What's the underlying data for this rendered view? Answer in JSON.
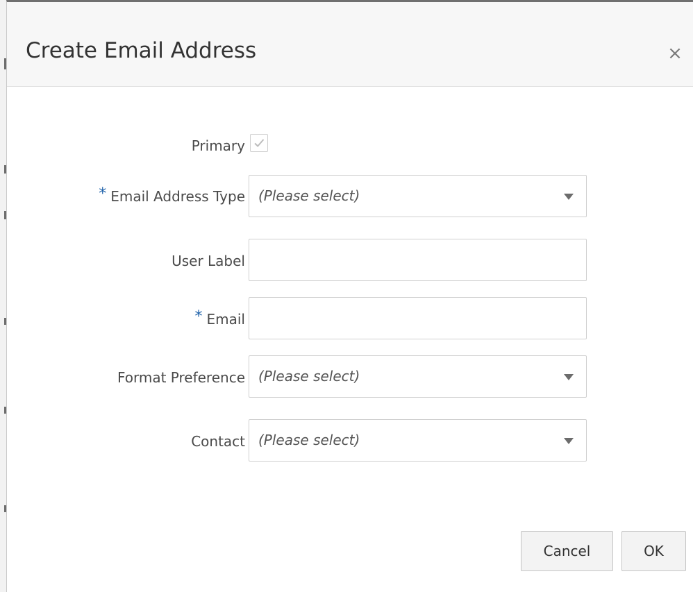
{
  "dialog": {
    "title": "Create Email Address",
    "close_glyph": "×"
  },
  "form": {
    "primary": {
      "label": "Primary",
      "checked": true
    },
    "email_address_type": {
      "required_mark": "*",
      "label": "Email Address Type",
      "value": "(Please select)"
    },
    "user_label": {
      "label": "User Label",
      "value": ""
    },
    "email": {
      "required_mark": "*",
      "label": "Email",
      "value": ""
    },
    "format_preference": {
      "label": "Format Preference",
      "value": "(Please select)"
    },
    "contact": {
      "label": "Contact",
      "value": "(Please select)"
    }
  },
  "buttons": {
    "cancel": "Cancel",
    "ok": "OK"
  },
  "icons": {
    "close": "close-icon",
    "checkmark": "checkmark-icon",
    "dropdown": "chevron-down-icon"
  },
  "colors": {
    "required_star": "#1b5fa8",
    "header_bg": "#f7f7f7"
  }
}
